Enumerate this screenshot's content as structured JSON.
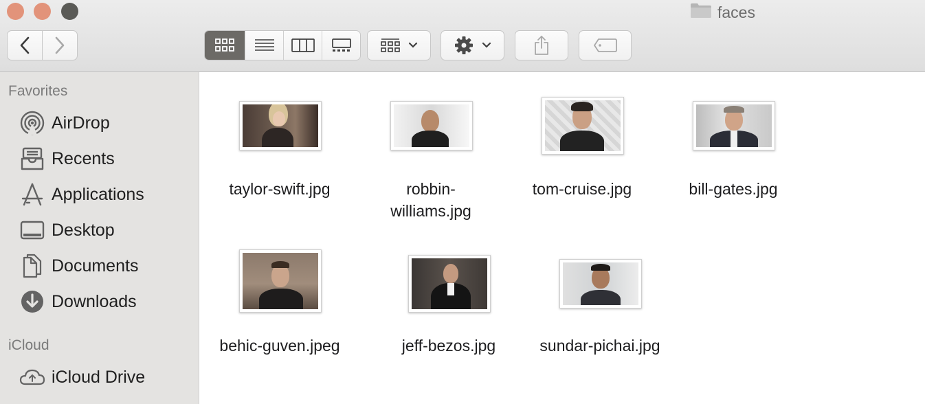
{
  "window": {
    "title": "faces",
    "folder_icon": "folder-icon"
  },
  "toolbar": {
    "back_icon": "chevron-left-icon",
    "forward_icon": "chevron-right-icon",
    "view_modes": [
      "icon-view",
      "list-view",
      "column-view",
      "gallery-view"
    ],
    "active_view": "icon-view",
    "group_icon": "group-by-icon",
    "action_icon": "gear-icon",
    "share_icon": "share-icon",
    "tag_icon": "tag-icon"
  },
  "sidebar": {
    "favorites_label": "Favorites",
    "favorites": [
      {
        "label": "AirDrop",
        "icon": "airdrop-icon"
      },
      {
        "label": "Recents",
        "icon": "recents-icon"
      },
      {
        "label": "Applications",
        "icon": "applications-icon"
      },
      {
        "label": "Desktop",
        "icon": "desktop-icon"
      },
      {
        "label": "Documents",
        "icon": "documents-icon"
      },
      {
        "label": "Downloads",
        "icon": "downloads-icon"
      }
    ],
    "icloud_label": "iCloud",
    "icloud": [
      {
        "label": "iCloud Drive",
        "icon": "icloud-icon"
      }
    ]
  },
  "files": [
    {
      "name_line1": "taylor-swift.jpg",
      "name_line2": ""
    },
    {
      "name_line1": "robbin-",
      "name_line2": "williams.jpg"
    },
    {
      "name_line1": "tom-cruise.jpg",
      "name_line2": ""
    },
    {
      "name_line1": "bill-gates.jpg",
      "name_line2": ""
    },
    {
      "name_line1": "behic-guven.jpeg",
      "name_line2": ""
    },
    {
      "name_line1": "jeff-bezos.jpg",
      "name_line2": ""
    },
    {
      "name_line1": "sundar-pichai.jpg",
      "name_line2": ""
    }
  ],
  "colors": {
    "active_segment": "#6c6a66",
    "sidebar_bg": "#e4e3e1",
    "close": "#e2937a",
    "zoom": "#5a5a56"
  }
}
